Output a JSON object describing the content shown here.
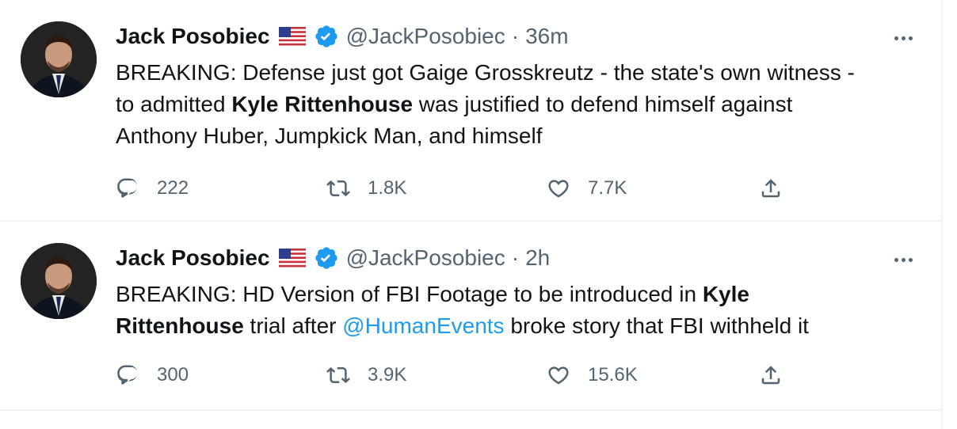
{
  "tweets": [
    {
      "author_name": "Jack Posobiec",
      "handle": "@JackPosobiec",
      "separator": "·",
      "time": "36m",
      "text_parts": [
        {
          "text": "BREAKING: Defense just got Gaige Grosskreutz - the state's own witness -\nto admitted ",
          "style": "normal"
        },
        {
          "text": "Kyle Rittenhouse",
          "style": "bold"
        },
        {
          "text": " was justified to defend himself against\nAnthony Huber, Jumpkick Man, and himself",
          "style": "normal"
        }
      ],
      "replies": "222",
      "retweets": "1.8K",
      "likes": "7.7K"
    },
    {
      "author_name": "Jack Posobiec",
      "handle": "@JackPosobiec",
      "separator": "·",
      "time": "2h",
      "text_parts": [
        {
          "text": "BREAKING: HD Version of FBI Footage to be introduced in ",
          "style": "normal"
        },
        {
          "text": "Kyle\nRittenhouse",
          "style": "bold"
        },
        {
          "text": " trial after ",
          "style": "normal"
        },
        {
          "text": "@HumanEvents",
          "style": "mention"
        },
        {
          "text": " broke story that FBI withheld it",
          "style": "normal"
        }
      ],
      "replies": "300",
      "retweets": "3.9K",
      "likes": "15.6K"
    }
  ],
  "icons": {
    "flag": "us-flag-icon",
    "verified": "verified-badge-icon",
    "more": "more-options-icon",
    "reply": "reply-icon",
    "retweet": "retweet-icon",
    "like": "heart-icon",
    "share": "share-icon"
  },
  "colors": {
    "accent": "#1d9bf0",
    "secondary_text": "#536471",
    "divider": "#eff3f4"
  }
}
